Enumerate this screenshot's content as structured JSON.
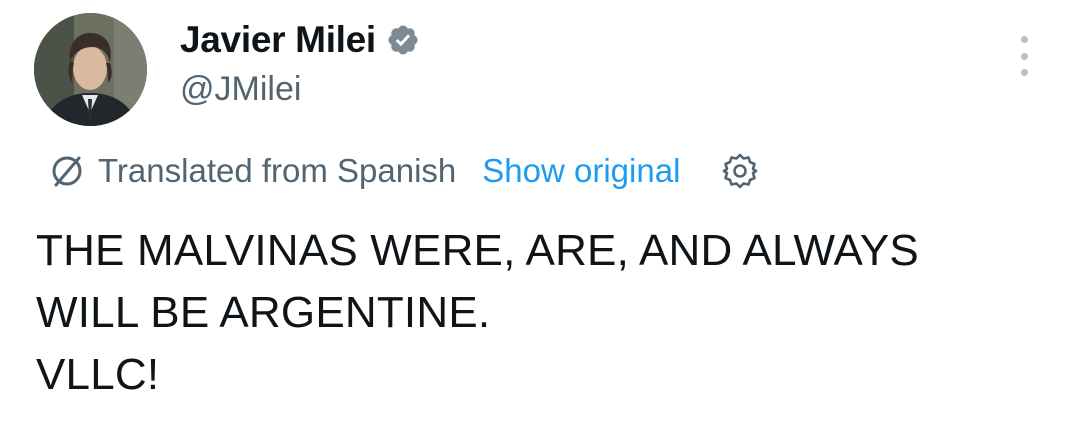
{
  "author": {
    "display_name": "Javier Milei",
    "handle": "@JMilei",
    "verified_icon": "verified-badge-icon",
    "verified_color": "#7d8a95"
  },
  "translation": {
    "label": "Translated from Spanish",
    "show_original": "Show original",
    "link_color": "#1d9bf0"
  },
  "tweet": {
    "lines": [
      "THE MALVINAS WERE, ARE, AND ALWAYS",
      "WILL BE ARGENTINE.",
      "VLLC!"
    ]
  },
  "icons": {
    "more": "more-icon",
    "translate": "translate-icon",
    "settings": "gear-icon"
  }
}
